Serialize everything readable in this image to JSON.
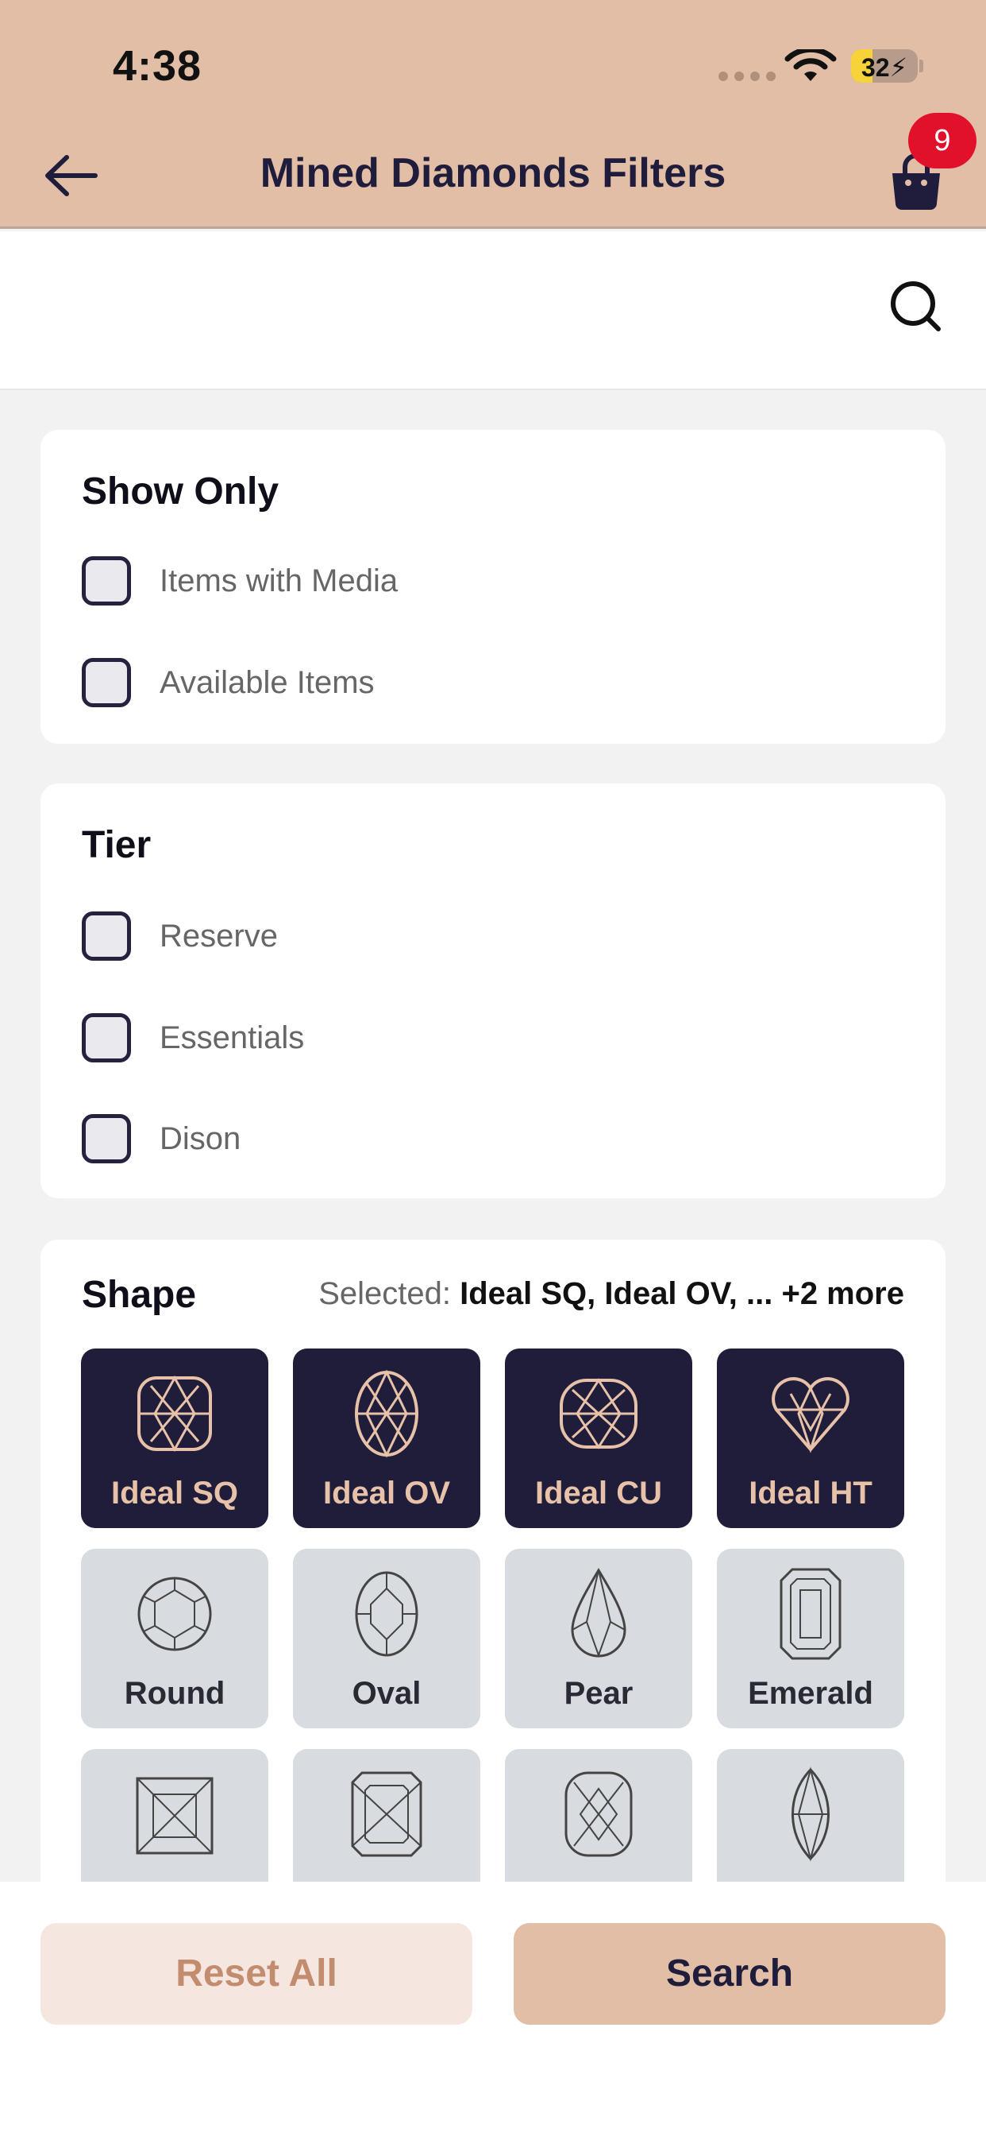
{
  "status": {
    "time": "4:38",
    "battery": "32"
  },
  "nav": {
    "title": "Mined Diamonds Filters",
    "cart_count": "9"
  },
  "search": {
    "placeholder": ""
  },
  "show_only": {
    "title": "Show Only",
    "options": [
      "Items with Media",
      "Available Items"
    ]
  },
  "tier": {
    "title": "Tier",
    "options": [
      "Reserve",
      "Essentials",
      "Dison"
    ]
  },
  "shape": {
    "title": "Shape",
    "selected_prefix": "Selected:",
    "selected_value": "Ideal SQ, Ideal OV, ...  +2 more",
    "tiles": [
      {
        "name": "Ideal SQ",
        "selected": true,
        "icon": "ideal-square-diamond-icon"
      },
      {
        "name": "Ideal OV",
        "selected": true,
        "icon": "ideal-oval-diamond-icon"
      },
      {
        "name": "Ideal CU",
        "selected": true,
        "icon": "ideal-cushion-diamond-icon"
      },
      {
        "name": "Ideal HT",
        "selected": true,
        "icon": "ideal-heart-diamond-icon"
      },
      {
        "name": "Round",
        "selected": false,
        "icon": "round-diamond-icon"
      },
      {
        "name": "Oval",
        "selected": false,
        "icon": "oval-diamond-icon"
      },
      {
        "name": "Pear",
        "selected": false,
        "icon": "pear-diamond-icon"
      },
      {
        "name": "Emerald",
        "selected": false,
        "icon": "emerald-diamond-icon"
      }
    ],
    "partial_tiles": [
      "princess-diamond-icon",
      "radiant-diamond-icon",
      "cushion-diamond-icon",
      "marquise-diamond-icon"
    ]
  },
  "actions": {
    "reset": "Reset All",
    "search": "Search"
  },
  "colors": {
    "header": "#e1bea5",
    "accent_dark": "#1f1d3a",
    "badge": "#e1102b",
    "reset_bg": "#f5e6e0"
  }
}
